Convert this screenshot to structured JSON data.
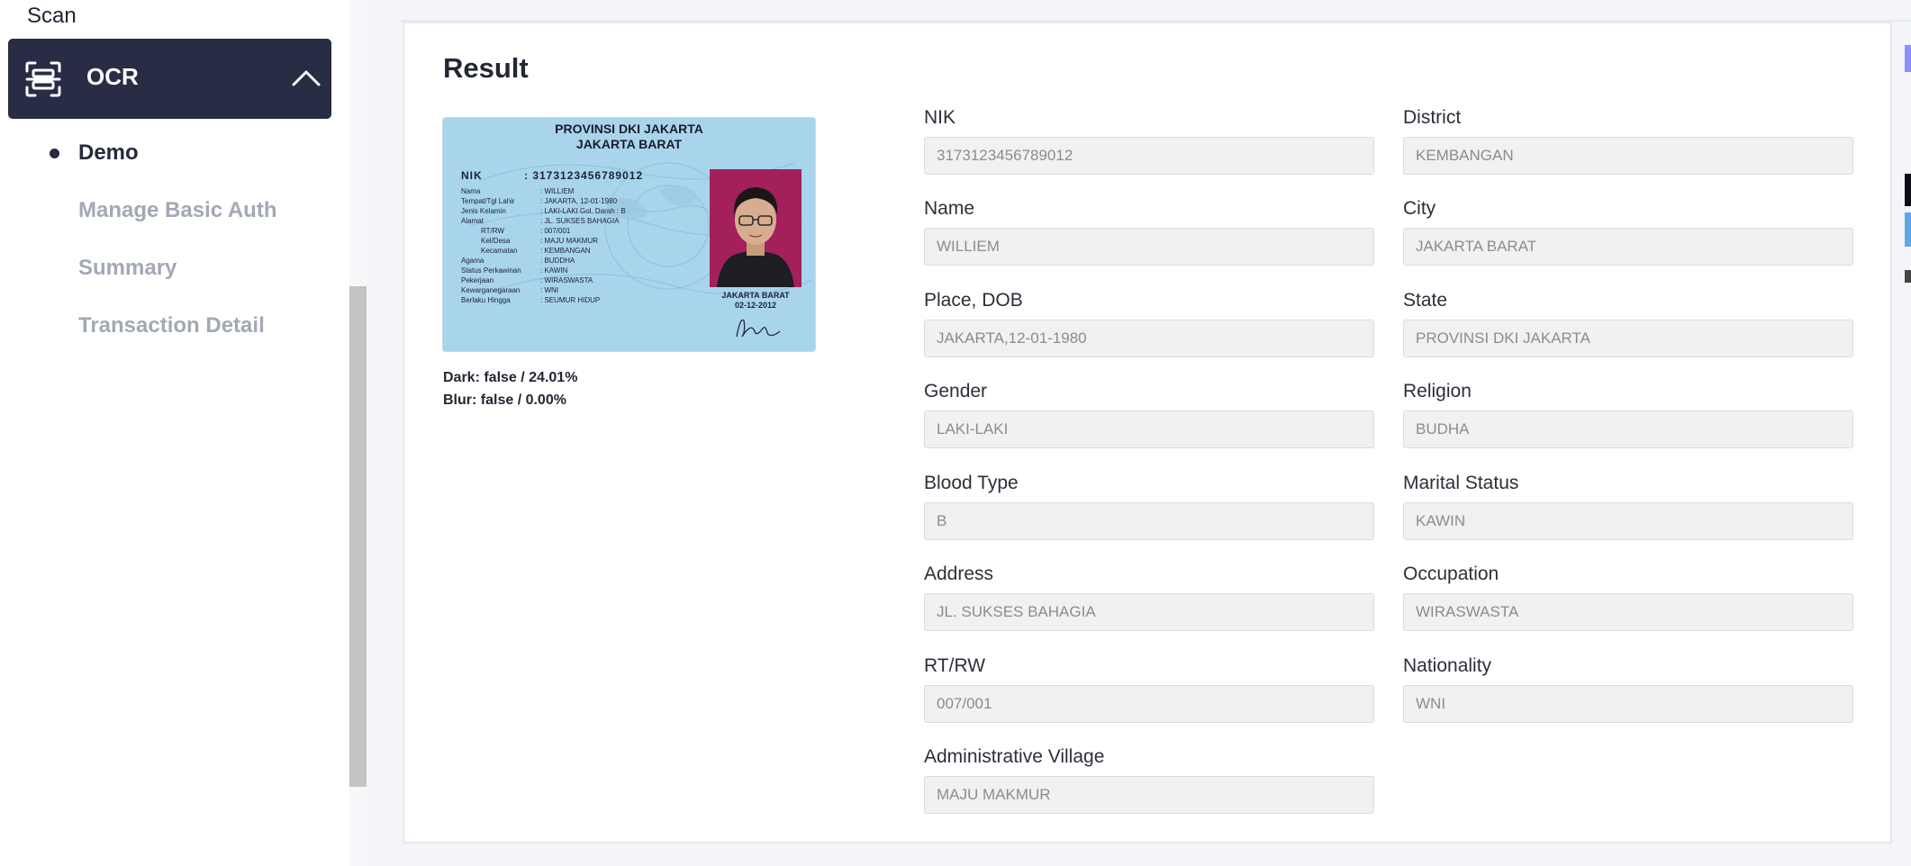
{
  "sidebar": {
    "section_label": "Scan",
    "group": {
      "title": "OCR",
      "icon": "scan-frame-icon",
      "expanded": true
    },
    "items": [
      {
        "label": "Demo",
        "active": true
      },
      {
        "label": "Manage Basic Auth",
        "active": false
      },
      {
        "label": "Summary",
        "active": false
      },
      {
        "label": "Transaction Detail",
        "active": false
      }
    ]
  },
  "result": {
    "title": "Result",
    "ktp_card": {
      "province": "PROVINSI DKI JAKARTA",
      "city": "JAKARTA BARAT",
      "nik_label": "NIK",
      "nik_value": ": 3173123456789012",
      "rows": [
        {
          "label": "Nama",
          "value": ": WILLIEM"
        },
        {
          "label": "Tempat/Tgl Lahir",
          "value": ": JAKARTA, 12-01-1980"
        },
        {
          "label": "Jenis Kelamin",
          "value": ": LAKI-LAKI        Gol. Darah : B"
        },
        {
          "label": "Alamat",
          "value": ": JL. SUKSES BAHAGIA"
        },
        {
          "label": "    RT/RW",
          "value": ": 007/001"
        },
        {
          "label": "    Kel/Desa",
          "value": ": MAJU MAKMUR"
        },
        {
          "label": "    Kecamatan",
          "value": ": KEMBANGAN"
        },
        {
          "label": "Agama",
          "value": ": BUDDHA"
        },
        {
          "label": "Status Perkawinan",
          "value": ": KAWIN"
        },
        {
          "label": "Pekerjaan",
          "value": ": WIRASWASTA"
        },
        {
          "label": "Kewarganegaraan",
          "value": ": WNI"
        },
        {
          "label": "Berlaku Hingga",
          "value": ": SEUMUR HIDUP"
        }
      ],
      "issue_place": "JAKARTA BARAT",
      "issue_date": "02-12-2012"
    },
    "dark": "Dark: false / 24.01%",
    "blur": "Blur: false / 0.00%",
    "fields_left": [
      {
        "label": "NIK",
        "value": "3173123456789012"
      },
      {
        "label": "Name",
        "value": "WILLIEM"
      },
      {
        "label": "Place, DOB",
        "value": "JAKARTA,12-01-1980"
      },
      {
        "label": "Gender",
        "value": "LAKI-LAKI"
      },
      {
        "label": "Blood Type",
        "value": "B"
      },
      {
        "label": "Address",
        "value": "JL. SUKSES BAHAGIA"
      },
      {
        "label": "RT/RW",
        "value": "007/001"
      },
      {
        "label": "Administrative Village",
        "value": "MAJU MAKMUR"
      }
    ],
    "fields_right": [
      {
        "label": "District",
        "value": "KEMBANGAN"
      },
      {
        "label": "City",
        "value": "JAKARTA BARAT"
      },
      {
        "label": "State",
        "value": "PROVINSI DKI JAKARTA"
      },
      {
        "label": "Religion",
        "value": "BUDHA"
      },
      {
        "label": "Marital Status",
        "value": "KAWIN"
      },
      {
        "label": "Occupation",
        "value": "WIRASWASTA"
      },
      {
        "label": "Nationality",
        "value": "WNI"
      }
    ]
  },
  "colors": {
    "sidebar_active_bg": "#292c45",
    "muted_text": "#a2a8b5",
    "input_bg": "#f1f1f1"
  }
}
